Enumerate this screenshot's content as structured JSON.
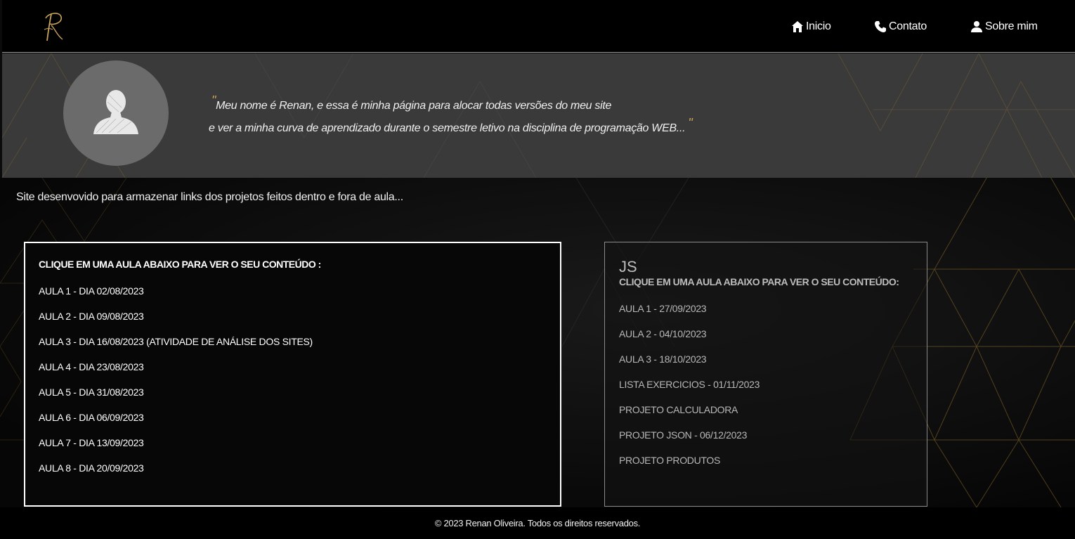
{
  "colors": {
    "accent_gold": "#c9a45c",
    "header_bg": "#000000",
    "hero_bg": "#3a3a3a",
    "panel_border": "#ffffff"
  },
  "header": {
    "logo_icon": "script-r-logo",
    "nav": [
      {
        "label": "Inicio",
        "icon": "home-icon"
      },
      {
        "label": "Contato",
        "icon": "phone-icon"
      },
      {
        "label": "Sobre mim",
        "icon": "user-icon"
      }
    ]
  },
  "hero": {
    "avatar_icon": "person-silhouette",
    "quote_open": "\"",
    "quote_line1": "Meu nome é Renan, e essa é minha página para alocar todas versões do meu site",
    "quote_line2": "e ver a minha curva de aprendizado durante o semestre letivo na disciplina de programação WEB...",
    "quote_close": "\""
  },
  "main": {
    "intro": "Site desenvovido para armazenar links dos projetos feitos dentro e fora de aula...",
    "left_panel": {
      "heading": "CLIQUE EM UMA AULA ABAIXO PARA VER O SEU CONTEÚDO :",
      "items": [
        "AULA 1 - DIA 02/08/2023",
        "AULA 2 - DIA 09/08/2023",
        "AULA 3 - DIA 16/08/2023 (ATIVIDADE DE ANÁLISE DOS SITES)",
        "AULA 4 - DIA 23/08/2023",
        "AULA 5 - DIA 31/08/2023",
        "AULA 6 - DIA 06/09/2023",
        "AULA 7 - DIA 13/09/2023",
        "AULA 8 - DIA 20/09/2023"
      ]
    },
    "right_panel": {
      "title": "JS",
      "heading": "CLIQUE EM UMA AULA ABAIXO PARA VER O SEU CONTEÚDO:",
      "items": [
        "AULA 1 - 27/09/2023",
        "AULA 2 - 04/10/2023",
        "AULA 3 - 18/10/2023",
        "LISTA EXERCICIOS - 01/11/2023",
        "PROJETO CALCULADORA",
        "PROJETO JSON - 06/12/2023",
        "PROJETO PRODUTOS"
      ]
    }
  },
  "footer": {
    "text": "© 2023 Renan Oliveira. Todos os direitos reservados."
  }
}
